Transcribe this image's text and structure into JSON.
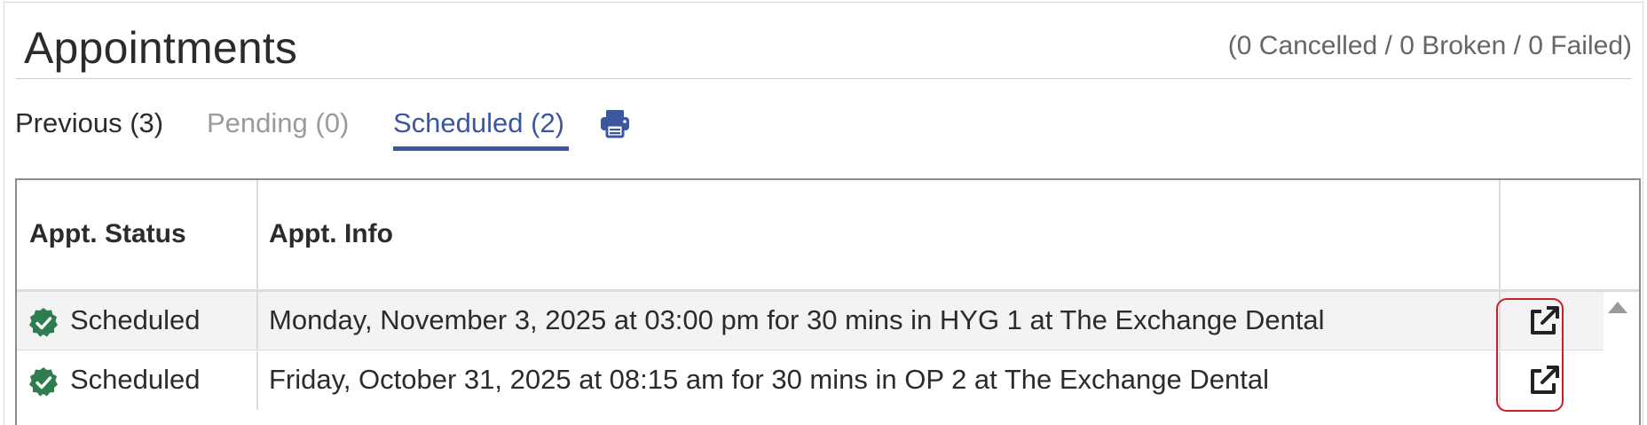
{
  "header": {
    "title": "Appointments",
    "counts": "(0 Cancelled / 0 Broken / 0 Failed)"
  },
  "tabs": [
    {
      "label": "Previous (3)",
      "state": "default"
    },
    {
      "label": "Pending (0)",
      "state": "disabled"
    },
    {
      "label": "Scheduled (2)",
      "state": "active"
    }
  ],
  "toolbar": {
    "print_icon": "print-icon"
  },
  "table": {
    "columns": [
      "Appt. Status",
      "Appt. Info",
      ""
    ],
    "rows": [
      {
        "status": "Scheduled",
        "info": "Monday, November 3, 2025 at 03:00 pm for 30 mins in HYG 1 at The Exchange Dental",
        "action_icon": "external-link-icon"
      },
      {
        "status": "Scheduled",
        "info": "Friday, October 31, 2025 at 08:15 am for 30 mins in OP 2 at The Exchange Dental",
        "action_icon": "external-link-icon"
      }
    ]
  },
  "colors": {
    "accent": "#3b57a0",
    "status_ok": "#2e7d4f",
    "highlight": "#c81e2c"
  }
}
